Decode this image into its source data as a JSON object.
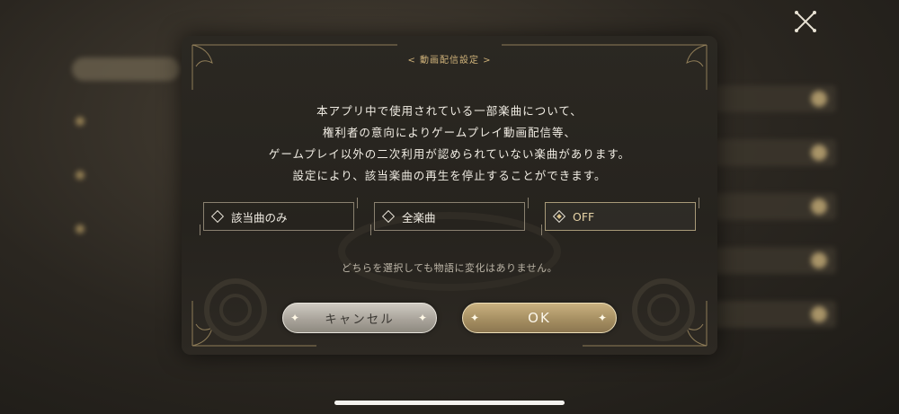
{
  "dialog": {
    "title": "< 動画配信設定 >",
    "description": [
      "本アプリ中で使用されている一部楽曲について、",
      "権利者の意向によりゲームプレイ動画配信等、",
      "ゲームプレイ以外の二次利用が認められていない楽曲があります。",
      "設定により、該当楽曲の再生を停止することができます。"
    ],
    "options": [
      {
        "label": "該当曲のみ",
        "selected": false
      },
      {
        "label": "全楽曲",
        "selected": false
      },
      {
        "label": "OFF",
        "selected": true
      }
    ],
    "note": "どちらを選択しても物語に変化はありません。",
    "cancel_label": "キャンセル",
    "ok_label": "OK"
  },
  "icons": {
    "close": "close-x-icon",
    "option_marker": "diamond-icon",
    "sparkle": "sparkle-icon"
  },
  "colors": {
    "accent_gold": "#cfb27a",
    "dialog_bg": "#2b2822",
    "text": "#f1ede4"
  }
}
